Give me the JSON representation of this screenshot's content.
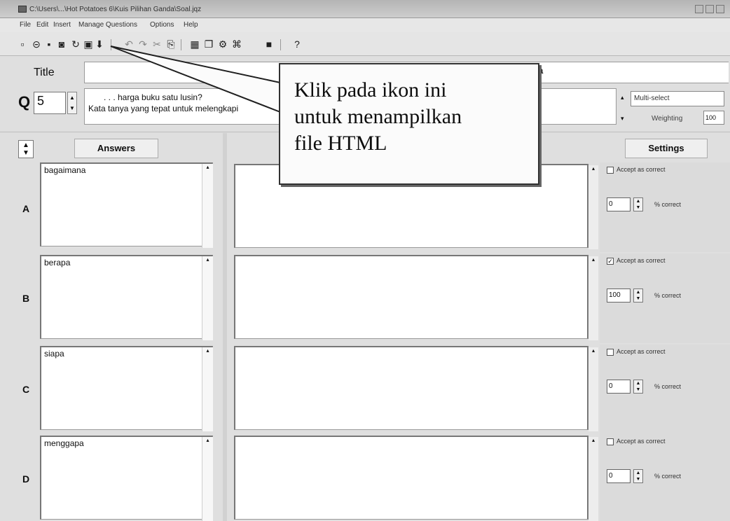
{
  "window": {
    "title": "C:\\Users\\...\\Hot Potatoes 6\\Kuis Pilihan Ganda\\Soal.jqz"
  },
  "menu": {
    "items": [
      "File",
      "Edit",
      "Insert",
      "Manage Questions",
      "Options",
      "Help"
    ]
  },
  "toolbar": {
    "icons": [
      "new-file-icon",
      "open-icon",
      "save-icon",
      "save-as-icon",
      "refresh-icon",
      "view-html-icon",
      "download-icon",
      "undo-icon",
      "redo-icon",
      "cut-icon",
      "paste-icon",
      "table-icon",
      "copy-icon",
      "compile-icon",
      "web-icon",
      "screen-icon",
      "help-icon"
    ]
  },
  "form": {
    "title_label": "Title",
    "title_value": "",
    "title_trailing": "a",
    "q_label": "Q",
    "q_number": "5",
    "question_line1": ". . . harga buku satu lusin?",
    "question_line2": "Kata tanya yang tepat untuk melengkapi",
    "question_type": "Multi-select",
    "weighting_label": "Weighting",
    "weighting_value": "100"
  },
  "headers": {
    "answers": "Answers",
    "settings": "Settings"
  },
  "answers": [
    {
      "letter": "A",
      "text": "bagaimana",
      "accept_label": "Accept as correct",
      "accepted": false,
      "percent": "0",
      "percent_label": "% correct"
    },
    {
      "letter": "B",
      "text": "berapa",
      "accept_label": "Accept as correct",
      "accepted": true,
      "percent": "100",
      "percent_label": "% correct"
    },
    {
      "letter": "C",
      "text": "siapa",
      "accept_label": "Accept as correct",
      "accepted": false,
      "percent": "0",
      "percent_label": "% correct"
    },
    {
      "letter": "D",
      "text": "menggapa",
      "accept_label": "Accept as correct",
      "accepted": false,
      "percent": "0",
      "percent_label": "% correct"
    }
  ],
  "callout": {
    "line1": "Klik pada ikon ini",
    "line2": "untuk menampilkan",
    "line3": "file HTML"
  }
}
